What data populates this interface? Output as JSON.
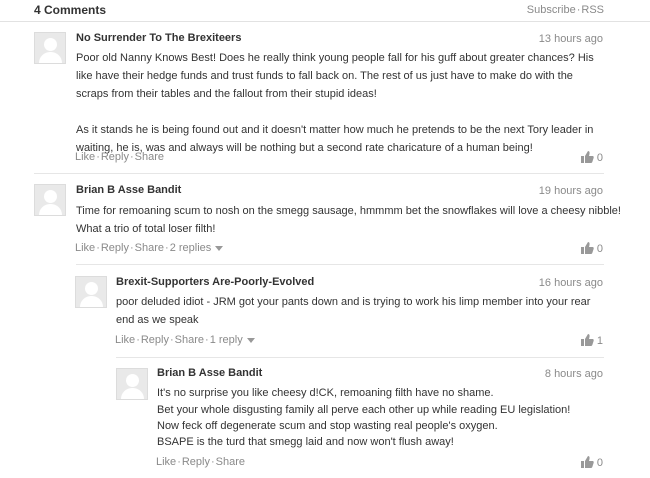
{
  "header": {
    "comment_count": "4 Comments",
    "subscribe_label": "Subscribe",
    "rss_label": "RSS",
    "sep": "·"
  },
  "comments": [
    {
      "author": "No Surrender To The Brexiteers",
      "time": "13 hours ago",
      "paragraphs": [
        "Poor old Nanny Knows Best! Does he really think young people fall for his guff about greater chances? His like have their hedge funds and trust funds to fall back on. The rest of us just have to make do with the scraps from their tables and the fallout from their stupid ideas!",
        "As it stands he is being found out and it doesn't matter how much he pretends to be the next Tory leader in waiting, he is, was and always will be nothing but a second rate charicature of a human being!"
      ],
      "like": "Like",
      "reply": "Reply",
      "share": "Share",
      "replies": "",
      "likes": "0"
    },
    {
      "author": "Brian B Asse Bandit",
      "time": "19 hours ago",
      "paragraphs": [
        "Time for remoaning scum to nosh on the smegg sausage, hmmmm bet the snowflakes will love a cheesy nibble! What a trio of total loser filth!"
      ],
      "like": "Like",
      "reply": "Reply",
      "share": "Share",
      "replies": "2 replies",
      "likes": "0"
    },
    {
      "author": "Brexit-Supporters Are-Poorly-Evolved",
      "time": "16 hours ago",
      "paragraphs": [
        "poor deluded idiot - JRM got your pants down and is trying to work his limp member into your rear end as we speak"
      ],
      "like": "Like",
      "reply": "Reply",
      "share": "Share",
      "replies": "1 reply",
      "likes": "1"
    },
    {
      "author": "Brian B Asse Bandit",
      "time": "8 hours ago",
      "lines": [
        "It's no surprise you like cheesy d!CK, remoaning filth have no shame.",
        "Bet your whole disgusting family all perve each other up while reading EU legislation!",
        "Now feck off degenerate scum and stop wasting real people's oxygen.",
        "BSAPE is the turd that smegg laid and now won't flush away!"
      ],
      "like": "Like",
      "reply": "Reply",
      "share": "Share",
      "replies": "",
      "likes": "0"
    }
  ],
  "colors": {
    "muted": "#8a8a8a",
    "text": "#333333",
    "divider": "#e6e6e6"
  }
}
